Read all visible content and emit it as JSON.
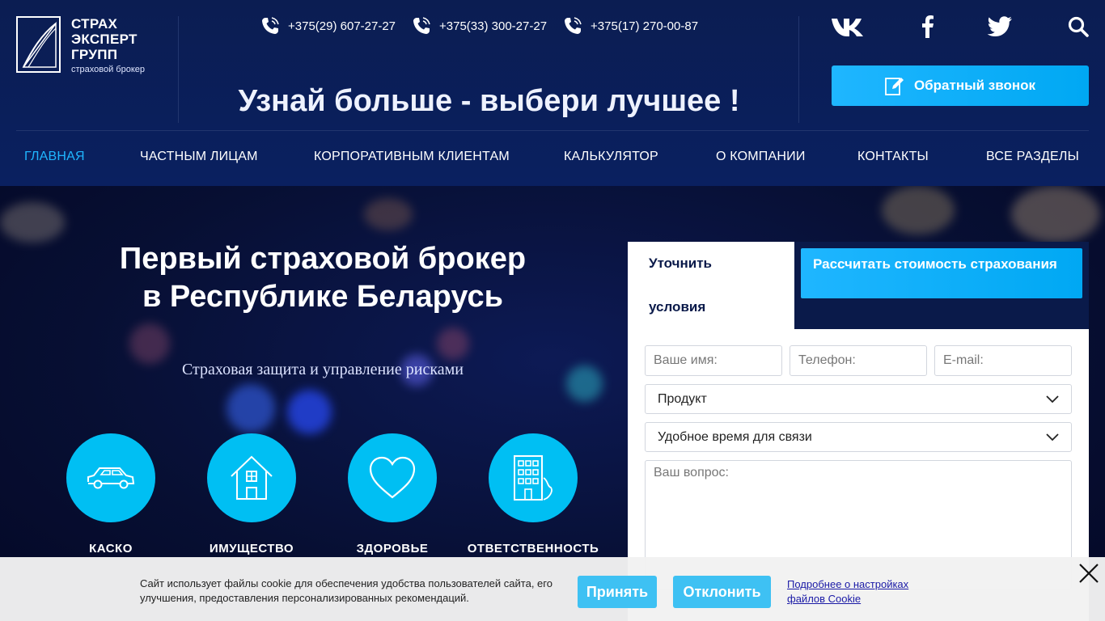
{
  "logo": {
    "lines": [
      "СТРАХ",
      "ЭКСПЕРТ",
      "ГРУПП"
    ],
    "subtitle": "страховой брокер"
  },
  "phones": [
    "+375(29) 607-27-27",
    "+375(33) 300-27-27",
    "+375(17) 270-00-87"
  ],
  "slogan": "Узнай больше - выбери лучшее !",
  "social": [
    "vk-icon",
    "facebook-icon",
    "twitter-icon",
    "search-icon"
  ],
  "callback_label": "Обратный звонок",
  "nav": [
    "ГЛАВНАЯ",
    "ЧАСТНЫМ ЛИЦАМ",
    "КОРПОРАТИВНЫМ КЛИЕНТАМ",
    "КАЛЬКУЛЯТОР",
    "О КОМПАНИИ",
    "КОНТАКТЫ",
    "ВСЕ РАЗДЕЛЫ"
  ],
  "hero": {
    "title_line1": "Первый страховой брокер",
    "title_line2": "в Республике Беларусь",
    "subtitle": "Страховая защита и управление рисками"
  },
  "services": [
    "КАСКО",
    "ИМУЩЕСТВО",
    "ЗДОРОВЬЕ",
    "ОТВЕТСТВЕННОСТЬ"
  ],
  "form": {
    "tab_active_line1": "Уточнить",
    "tab_active_line2": "условия",
    "tab_calc": "Рассчитать стоимость страхования",
    "name_placeholder": "Ваше имя:",
    "phone_placeholder": "Телефон:",
    "email_placeholder": "E-mail:",
    "product_select": "Продукт",
    "time_select": "Удобное время для связи",
    "question_placeholder": "Ваш вопрос:"
  },
  "cookie": {
    "text": "Сайт использует файлы cookie для обеспечения удобства пользователей сайта, его улучшения, предоставления персонализированных рекомендаций.",
    "accept": "Принять",
    "decline": "Отклонить",
    "link": "Подробнее о настройках файлов Cookie"
  },
  "colors": {
    "accent": "#00bff3",
    "nav_active": "#1fb6ff",
    "header_bg": "#0b1d52"
  }
}
